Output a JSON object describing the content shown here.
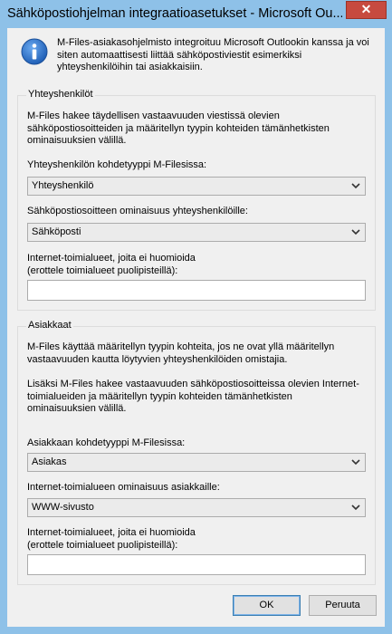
{
  "window": {
    "title": "Sähköpostiohjelman integraatioasetukset - Microsoft Ou...",
    "close_label": "✕"
  },
  "intro_text": "M-Files-asiakasohjelmisto integroituu Microsoft Outlookin kanssa ja voi siten automaattisesti liittää sähköpostiviestit esimerkiksi yhteyshenkilöihin tai asiakkaisiin.",
  "contacts": {
    "title": "Yhteyshenkilöt",
    "description": "M-Files hakee täydellisen vastaavuuden viestissä olevien sähköpostiosoitteiden ja määritellyn tyypin kohteiden tämänhetkisten ominaisuuksien välillä.",
    "type_label": "Yhteyshenkilön kohdetyyppi M-Filesissa:",
    "type_value": "Yhteyshenkilö",
    "email_label": "Sähköpostiosoitteen ominaisuus yhteyshenkilöille:",
    "email_value": "Sähköposti",
    "domains_label_line1": "Internet-toimialueet, joita ei huomioida",
    "domains_label_line2": "(erottele toimialueet puolipisteillä):",
    "domains_value": ""
  },
  "customers": {
    "title": "Asiakkaat",
    "description1": "M-Files käyttää määritellyn tyypin kohteita, jos ne ovat yllä määritellyn vastaavuuden kautta löytyvien yhteyshenkilöiden omistajia.",
    "description2": "Lisäksi M-Files hakee vastaavuuden sähköpostiosoitteissa olevien Internet-toimialueiden ja määritellyn tyypin kohteiden tämänhetkisten ominaisuuksien välillä.",
    "type_label": "Asiakkaan kohdetyyppi M-Filesissa:",
    "type_value": "Asiakas",
    "domain_prop_label": "Internet-toimialueen ominaisuus asiakkaille:",
    "domain_prop_value": "WWW-sivusto",
    "domains_label_line1": "Internet-toimialueet, joita ei huomioida",
    "domains_label_line2": "(erottele toimialueet puolipisteillä):",
    "domains_value": ""
  },
  "buttons": {
    "ok": "OK",
    "cancel": "Peruuta"
  },
  "icons": {
    "info": "info-icon",
    "close": "close-icon",
    "dropdown": "chevron-down-icon"
  }
}
